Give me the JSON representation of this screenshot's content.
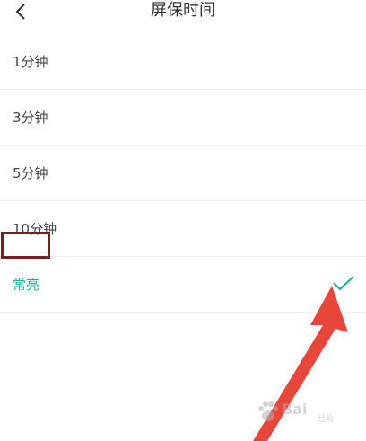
{
  "header": {
    "title": "屏保时间"
  },
  "options": [
    {
      "label": "1分钟"
    },
    {
      "label": "3分钟"
    },
    {
      "label": "5分钟"
    },
    {
      "label": "10分钟"
    },
    {
      "label": "常亮",
      "selected": true
    }
  ],
  "watermark": {
    "brand": "Bai",
    "sub": "经验"
  },
  "icons": {
    "back": "chevron-left-icon",
    "check": "check-icon",
    "annotation_arrow": "arrow-icon"
  },
  "colors": {
    "accent": "#1cae9c",
    "highlight_border": "#7a1f1f",
    "arrow": "#e8463a"
  }
}
